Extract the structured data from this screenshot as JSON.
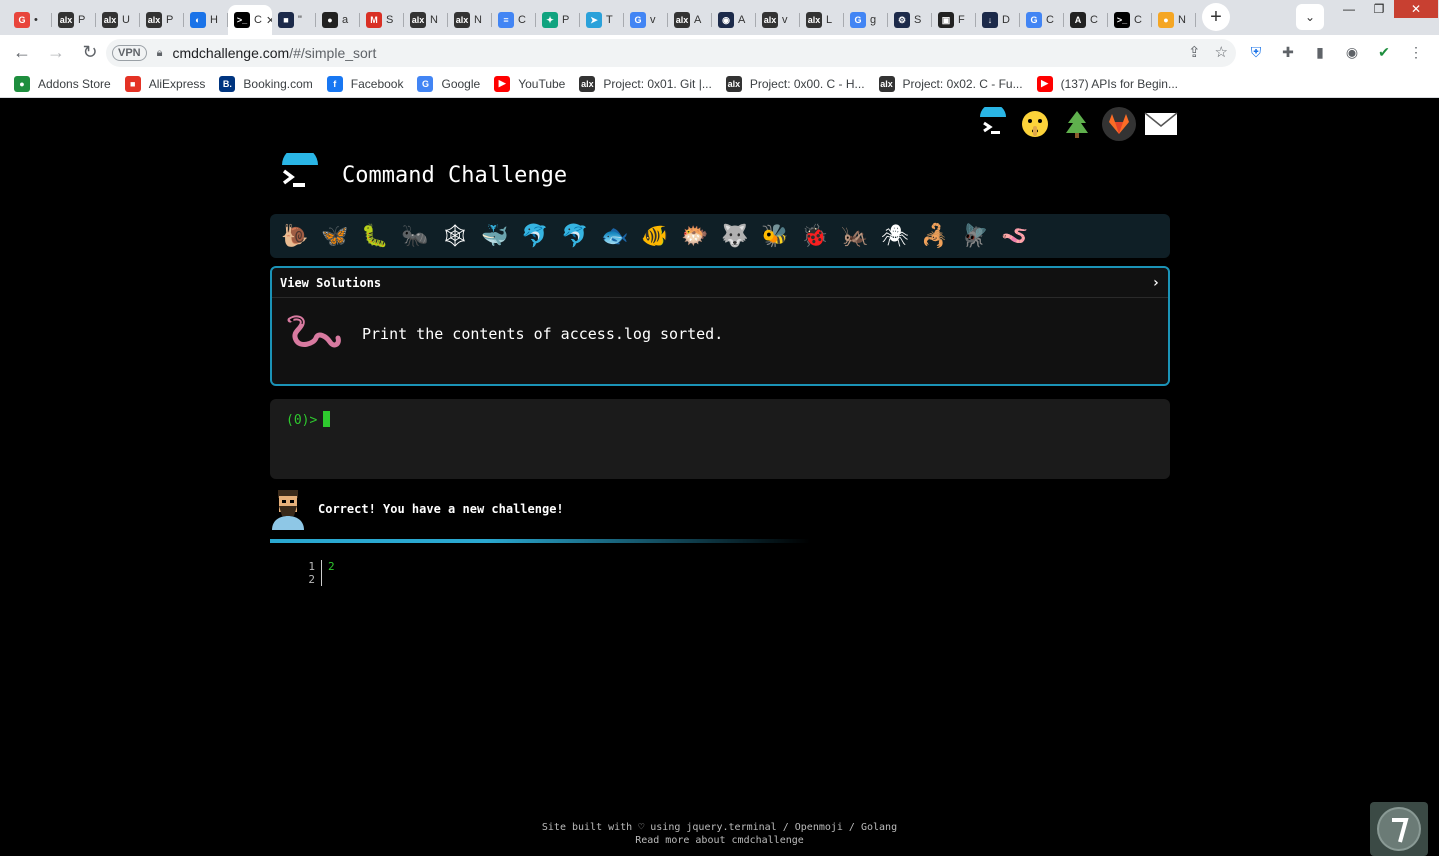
{
  "browser": {
    "tabs": [
      {
        "fav": "G",
        "color": "#e8453c",
        "label": "•"
      },
      {
        "fav": "alx",
        "color": "#333",
        "label": "P"
      },
      {
        "fav": "alx",
        "color": "#333",
        "label": "U"
      },
      {
        "fav": "alx",
        "color": "#333",
        "label": "P"
      },
      {
        "fav": "◐",
        "color": "#1a73e8",
        "label": "H"
      },
      {
        "fav": ">_",
        "color": "#000",
        "label": "C"
      },
      {
        "fav": "■",
        "color": "#1c2a4a",
        "label": "\""
      },
      {
        "fav": "●",
        "color": "#222",
        "label": "a"
      },
      {
        "fav": "M",
        "color": "#d93025",
        "label": "S"
      },
      {
        "fav": "alx",
        "color": "#333",
        "label": "N"
      },
      {
        "fav": "alx",
        "color": "#333",
        "label": "N"
      },
      {
        "fav": "≡",
        "color": "#4285f4",
        "label": "C"
      },
      {
        "fav": "✦",
        "color": "#10a37f",
        "label": "P"
      },
      {
        "fav": "➤",
        "color": "#2aa1da",
        "label": "T"
      },
      {
        "fav": "G",
        "color": "#4285f4",
        "label": "v"
      },
      {
        "fav": "alx",
        "color": "#333",
        "label": "A"
      },
      {
        "fav": "◉",
        "color": "#1c2a4a",
        "label": "A"
      },
      {
        "fav": "alx",
        "color": "#333",
        "label": "v"
      },
      {
        "fav": "alx",
        "color": "#333",
        "label": "L"
      },
      {
        "fav": "G",
        "color": "#4285f4",
        "label": "g"
      },
      {
        "fav": "⚙",
        "color": "#1c2a4a",
        "label": "S"
      },
      {
        "fav": "▣",
        "color": "#222",
        "label": "F"
      },
      {
        "fav": "↓",
        "color": "#1c2a4a",
        "label": "D"
      },
      {
        "fav": "G",
        "color": "#4285f4",
        "label": "C"
      },
      {
        "fav": "A",
        "color": "#222",
        "label": "C"
      },
      {
        "fav": ">_",
        "color": "#000",
        "label": "C"
      },
      {
        "fav": "●",
        "color": "#f5a623",
        "label": "N"
      }
    ],
    "url_host": "cmdchallenge.com",
    "url_path": "/#/simple_sort",
    "vpn_label": "VPN",
    "bookmarks": [
      {
        "icon": "●",
        "color": "#1e8e3e",
        "label": "Addons Store"
      },
      {
        "icon": "■",
        "color": "#e43225",
        "label": "AliExpress"
      },
      {
        "icon": "B.",
        "color": "#003580",
        "label": "Booking.com"
      },
      {
        "icon": "f",
        "color": "#1877f2",
        "label": "Facebook"
      },
      {
        "icon": "G",
        "color": "#4285f4",
        "label": "Google"
      },
      {
        "icon": "▶",
        "color": "#ff0000",
        "label": "YouTube"
      },
      {
        "icon": "alx",
        "color": "#333",
        "label": "Project: 0x01. Git |..."
      },
      {
        "icon": "alx",
        "color": "#333",
        "label": "Project: 0x00. C - H..."
      },
      {
        "icon": "alx",
        "color": "#333",
        "label": "Project: 0x02. C - Fu..."
      },
      {
        "icon": "▶",
        "color": "#ff0000",
        "label": "(137) APIs for Begin..."
      }
    ]
  },
  "page": {
    "title": "Command Challenge",
    "view_solutions": "View Solutions",
    "challenge_text": "Print the contents of access.log sorted.",
    "prompt": "(0)>",
    "feedback": "Correct! You have a new challenge!",
    "output_line_numbers": [
      "1",
      "2"
    ],
    "output_lines": [
      "2",
      ""
    ],
    "footer_line1": "Site built with ♡ using jquery.terminal / Openmoji / Golang",
    "footer_line2": "Read more about cmdchallenge",
    "critters": [
      "🐌",
      "🦋",
      "🐛",
      "🐜",
      "🕸",
      "🐳",
      "🐬",
      "🐬",
      "🐟",
      "🐠",
      "🐡",
      "🐺",
      "🐝",
      "🐞",
      "🦗",
      "🕷",
      "🦂",
      "🪰",
      "🪱"
    ]
  }
}
